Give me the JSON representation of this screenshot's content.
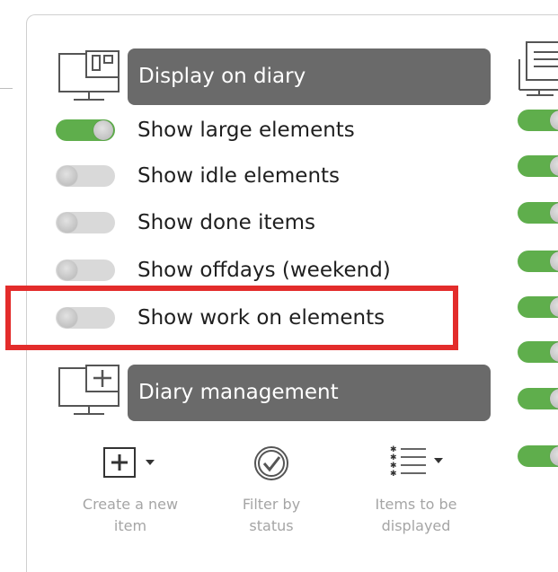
{
  "display_section": {
    "title": "Display on diary",
    "toggles": [
      {
        "label": "Show large elements",
        "on": true
      },
      {
        "label": "Show idle elements",
        "on": false
      },
      {
        "label": "Show done items",
        "on": false
      },
      {
        "label": "Show offdays (weekend)",
        "on": false
      },
      {
        "label": "Show work on elements",
        "on": false
      }
    ]
  },
  "management_section": {
    "title": "Diary management",
    "tools": [
      {
        "label_line1": "Create a new",
        "label_line2": "item",
        "icon": "add-box-icon"
      },
      {
        "label_line1": "Filter by",
        "label_line2": "status",
        "icon": "check-circle-icon"
      },
      {
        "label_line1": "Items to be",
        "label_line2": "displayed",
        "icon": "list-icon"
      }
    ]
  },
  "right_column": {
    "toggles_on": [
      true,
      true,
      true,
      true,
      true,
      true,
      true,
      true
    ]
  },
  "colors": {
    "header_bg": "#6a6a6a",
    "toggle_on": "#5fae4c",
    "toggle_off": "#d9d9d9",
    "highlight": "#e32c2b",
    "tool_label": "#a5a5a5"
  }
}
